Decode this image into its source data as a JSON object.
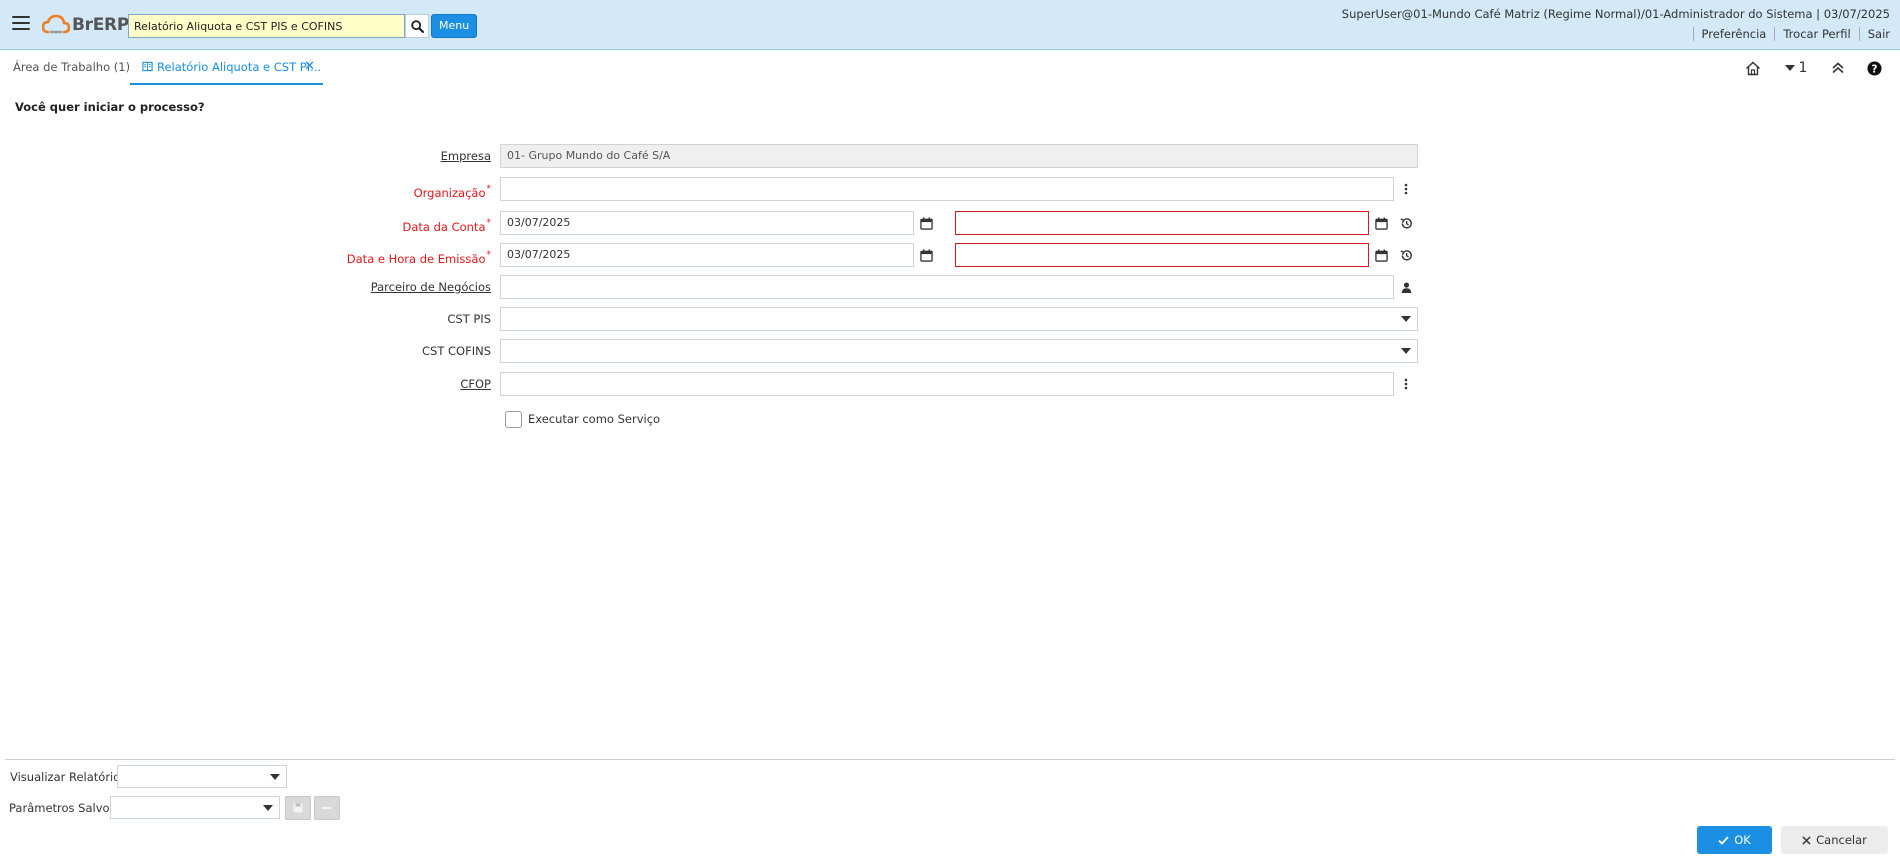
{
  "header": {
    "logo_text": "BrERP",
    "search_value": "Relatório Aliquota e CST PIS e COFINS",
    "menu_label": "Menu",
    "user_info": "SuperUser@01-Mundo Café Matriz (Regime Normal)/01-Administrador do Sistema | 03/07/2025",
    "links": [
      "Preferência",
      "Trocar Perfil",
      "Sair"
    ]
  },
  "tabs": {
    "home_label": "Área de Trabalho (1)",
    "active_label": "Relatório Aliquota e CST PI...",
    "window_count": "1"
  },
  "form": {
    "question": "Você quer iniciar o processo?",
    "fields": {
      "empresa": {
        "label": "Empresa",
        "value": "01- Grupo Mundo do Café S/A"
      },
      "organizacao": {
        "label": "Organização",
        "value": ""
      },
      "data_conta": {
        "label": "Data da Conta",
        "from": "03/07/2025",
        "to": ""
      },
      "data_emissao": {
        "label": "Data e Hora de Emissão",
        "from": "03/07/2025",
        "to": ""
      },
      "parceiro": {
        "label": "Parceiro de Negócios",
        "value": ""
      },
      "cst_pis": {
        "label": "CST PIS",
        "value": ""
      },
      "cst_cofins": {
        "label": "CST COFINS",
        "value": ""
      },
      "cfop": {
        "label": "CFOP",
        "value": ""
      }
    },
    "required_mark": "*",
    "run_as_service": {
      "label": "Executar como Serviço",
      "checked": false
    }
  },
  "footer": {
    "view_report_label": "Visualizar Relatório",
    "view_report_value": "",
    "saved_params_label": "Parâmetros Salvos",
    "saved_params_value": "",
    "ok_label": "OK",
    "cancel_label": "Cancelar"
  },
  "colors": {
    "accent": "#1a8fe3",
    "header_bg": "#d4e9f7",
    "required": "#e0171c",
    "search_bg": "#ffffc8"
  }
}
